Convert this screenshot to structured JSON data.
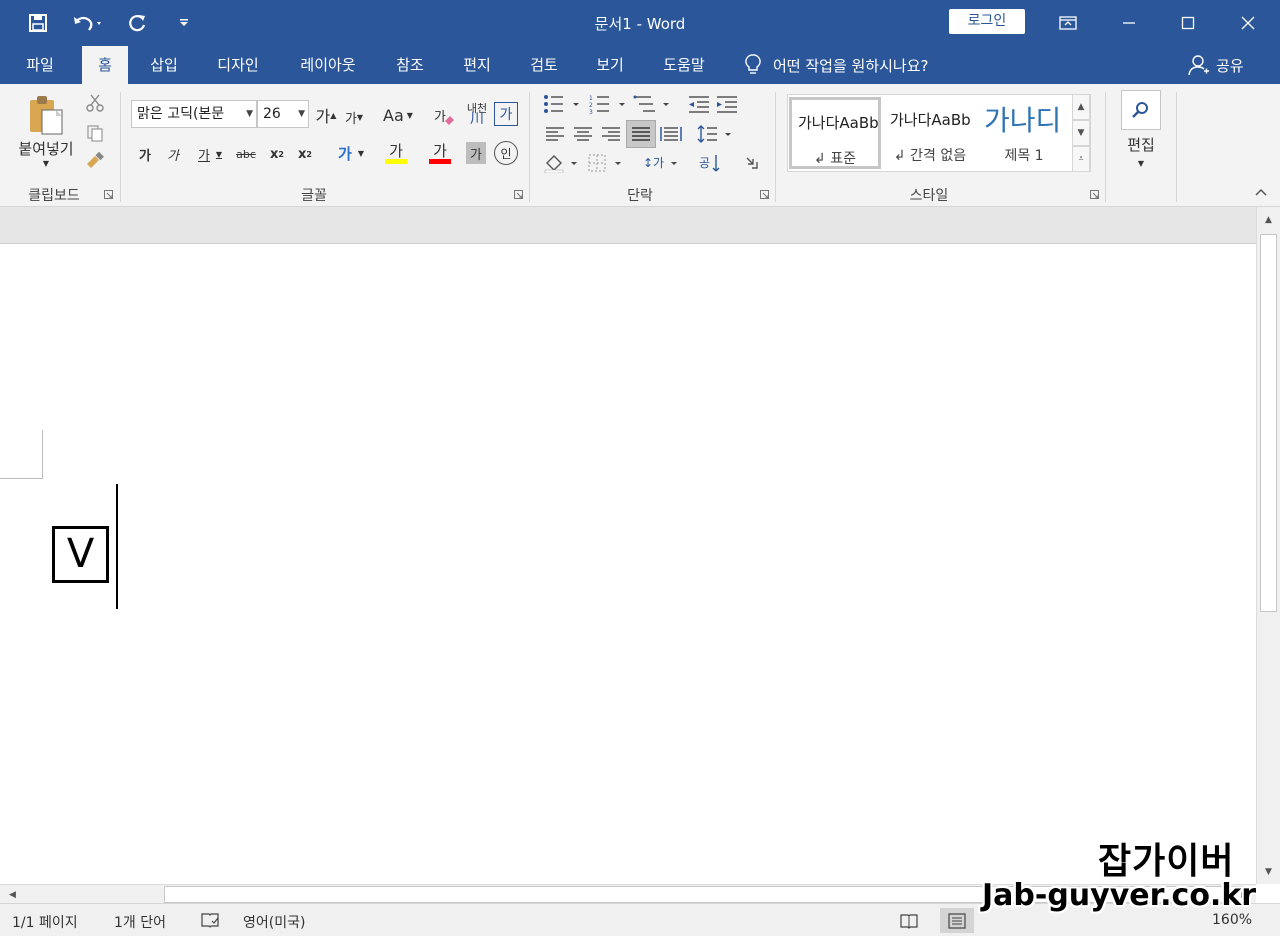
{
  "window": {
    "title": "문서1  -  Word",
    "login_label": "로그인"
  },
  "colors": {
    "accent": "#2b579a",
    "highlight": "#ffff00",
    "font_color": "#ff0000"
  },
  "tabs": [
    {
      "label": "파일"
    },
    {
      "label": "홈"
    },
    {
      "label": "삽입"
    },
    {
      "label": "디자인"
    },
    {
      "label": "레이아웃"
    },
    {
      "label": "참조"
    },
    {
      "label": "편지"
    },
    {
      "label": "검토"
    },
    {
      "label": "보기"
    },
    {
      "label": "도움말"
    }
  ],
  "active_tab": "홈",
  "tell_me": "어떤 작업을 원하시나요?",
  "share": "공유",
  "ribbon": {
    "clipboard": {
      "paste": "붙여넣기",
      "label": "클립보드"
    },
    "font": {
      "name": "맑은 고딕(본문",
      "size": "26",
      "label": "글꼴",
      "grow": "가",
      "shrink": "가",
      "case": "Aa",
      "clear": "가",
      "phonetic_top": "내천",
      "phonetic_bottom": "川",
      "border": "가",
      "bold": "가",
      "italic": "가",
      "underline": "가",
      "strike": "abc",
      "subscript": "x",
      "sub_mark": "2",
      "superscript": "x",
      "sup_mark": "2",
      "effects": "가",
      "highlight": "가",
      "color": "가",
      "shading": "가",
      "enclose": "인"
    },
    "paragraph": {
      "label": "단락"
    },
    "styles": {
      "label": "스타일",
      "items": [
        {
          "preview": "가나다AaBb",
          "name": "↲ 표준"
        },
        {
          "preview": "가나다AaBb",
          "name": "↲ 간격 없음"
        },
        {
          "preview": "가나디",
          "name": "제목 1"
        }
      ]
    },
    "editing": {
      "label": "편집"
    }
  },
  "document": {
    "content": "V"
  },
  "status": {
    "page": "1/1 페이지",
    "words": "1개 단어",
    "language": "영어(미국)",
    "zoom": "160%"
  },
  "watermark": {
    "title": "잡가이버",
    "url": "Jab-guyver.co.kr"
  }
}
